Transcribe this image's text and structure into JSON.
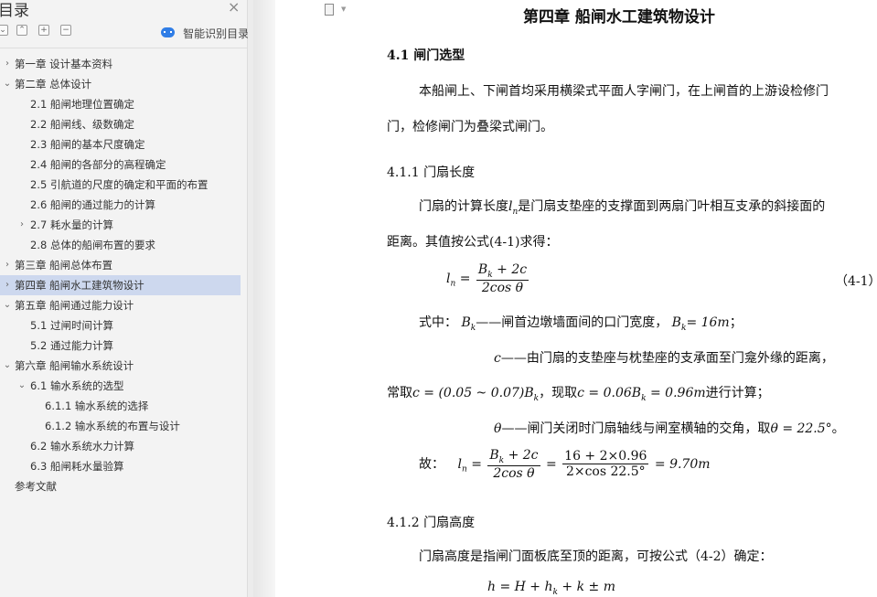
{
  "nav": {
    "title": "目录",
    "close": "×",
    "toolbar": {
      "collapse_all": "⌄",
      "expand_all": "⌃",
      "add": "+",
      "remove": "−",
      "smart_toc": "智能识别目录"
    },
    "items": [
      {
        "label": "第一章  设计基本资料",
        "arrow": "›",
        "level": 0
      },
      {
        "label": "第二章  总体设计",
        "arrow": "⌄",
        "level": 0
      },
      {
        "label": "2.1  船闸地理位置确定",
        "arrow": "",
        "level": 1
      },
      {
        "label": "2.2  船闸线、级数确定",
        "arrow": "",
        "level": 1
      },
      {
        "label": "2.3  船闸的基本尺度确定",
        "arrow": "",
        "level": 1
      },
      {
        "label": "2.4  船闸的各部分的高程确定",
        "arrow": "",
        "level": 1
      },
      {
        "label": "2.5  引航道的尺度的确定和平面的布置",
        "arrow": "",
        "level": 1
      },
      {
        "label": "2.6  船闸的通过能力的计算",
        "arrow": "",
        "level": 1
      },
      {
        "label": "2.7  耗水量的计算",
        "arrow": "›",
        "level": 1
      },
      {
        "label": "2.8  总体的船闸布置的要求",
        "arrow": "",
        "level": 1
      },
      {
        "label": "第三章  船闸总体布置",
        "arrow": "›",
        "level": 0
      },
      {
        "label": "第四章  船闸水工建筑物设计",
        "arrow": "›",
        "level": 0,
        "active": true
      },
      {
        "label": "第五章  船闸通过能力设计",
        "arrow": "⌄",
        "level": 0
      },
      {
        "label": "5.1 过闸时间计算",
        "arrow": "",
        "level": 1
      },
      {
        "label": "5.2 通过能力计算",
        "arrow": "",
        "level": 1
      },
      {
        "label": "第六章  船闸输水系统设计",
        "arrow": "⌄",
        "level": 0
      },
      {
        "label": "6.1 输水系统的选型",
        "arrow": "⌄",
        "level": 1
      },
      {
        "label": "6.1.1 输水系统的选择",
        "arrow": "",
        "level": 2
      },
      {
        "label": "6.1.2 输水系统的布置与设计",
        "arrow": "",
        "level": 2
      },
      {
        "label": "6.2 输水系统水力计算",
        "arrow": "",
        "level": 1
      },
      {
        "label": "6.3 船闸耗水量验算",
        "arrow": "",
        "level": 1
      },
      {
        "label": "参考文献",
        "arrow": "",
        "level": 0
      }
    ]
  },
  "doc": {
    "chapter_title": "第四章  船闸水工建筑物设计",
    "s41_title": "4.1 闸门选型",
    "s41_p1": "本船闸上、下闸首均采用横梁式平面人字闸门，在上闸首的上游设检修门",
    "s41_p2": "门，检修闸门为叠梁式闸门。",
    "s411_title": "4.1.1 门扇长度",
    "s411_p1a": "门扇的计算长度",
    "s411_p1_sym": "l",
    "s411_p1_sub": "n",
    "s411_p1b": "是门扇支垫座的支撑面到两扇门叶相互支承的斜接面的",
    "s411_p2": "距离。其值按公式(4-1)求得：",
    "eq1_lhs": "l",
    "eq1_lhs_sub": "n",
    "eq1_equals": "=",
    "eq1_num": "B",
    "eq1_num_sub": "k",
    "eq1_num_rest": " + 2c",
    "eq1_den": "2cos θ",
    "eq1_no": "（4-1）",
    "where_label": "式中：",
    "where_B": "B",
    "where_B_sub": "k",
    "where_B_desc": "——闸首边墩墙面间的口门宽度，",
    "where_B_val": "= 16m",
    "where_B_end": "；",
    "where_c_sym": "c",
    "where_c_desc": "——由门扇的支垫座与枕垫座的支承面至门龛外缘的距离，",
    "where_c2_a": "常取",
    "where_c2_formula": "c = (0.05 ~ 0.07)B",
    "where_c2_b": "，现取",
    "where_c2_formula2": "c = 0.06B",
    "where_c2_formula2_rest": " = 0.96m",
    "where_c2_c": "进行计算；",
    "theta_sym": "θ",
    "theta_desc": "——闸门关闭时门扇轴线与闸室横轴的交角，取",
    "theta_val": "θ = 22.5°",
    "theta_end": "。",
    "calc_label": "故：",
    "calc_num2": "16 + 2×0.96",
    "calc_den2": "2×cos 22.5°",
    "calc_result": "= 9.70m",
    "s412_title": "4.1.2 门扇高度",
    "s412_p1": "门扇高度是指闸门面板底至顶的距离，可按公式（4-2）确定：",
    "eq2": "h = H + h",
    "eq2_sub": "k",
    "eq2_rest": " + k ± m"
  }
}
